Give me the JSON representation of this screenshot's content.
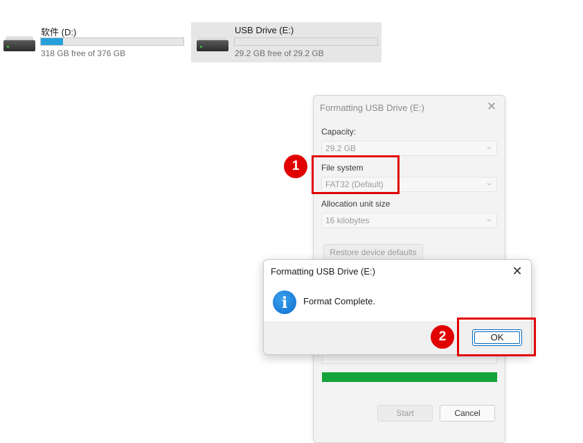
{
  "drives": [
    {
      "name": "软件 (D:)",
      "free_text": "318 GB free of 376 GB",
      "used_fraction": 0.154
    },
    {
      "name": "USB Drive (E:)",
      "free_text": "29.2 GB free of 29.2 GB",
      "used_fraction": 0.0
    }
  ],
  "format_dialog": {
    "title": "Formatting USB Drive (E:)",
    "capacity_label": "Capacity:",
    "capacity_value": "29.2 GB",
    "file_system_label": "File system",
    "file_system_value": "FAT32 (Default)",
    "allocation_label": "Allocation unit size",
    "allocation_value": "16 kilobytes",
    "restore_label": "Restore device defaults",
    "progress_fraction": 1.0,
    "progress_color": "#14a33a",
    "start_label": "Start",
    "cancel_label": "Cancel"
  },
  "message_box": {
    "title": "Formatting USB Drive (E:)",
    "message": "Format Complete.",
    "ok_label": "OK",
    "icon": "info-icon"
  },
  "annotations": {
    "marker1": "1",
    "marker2": "2",
    "highlight_color": "#e10000"
  },
  "icons": {
    "close": "close-icon",
    "drive": "hard-drive-icon",
    "chevron": "chevron-down-icon"
  }
}
